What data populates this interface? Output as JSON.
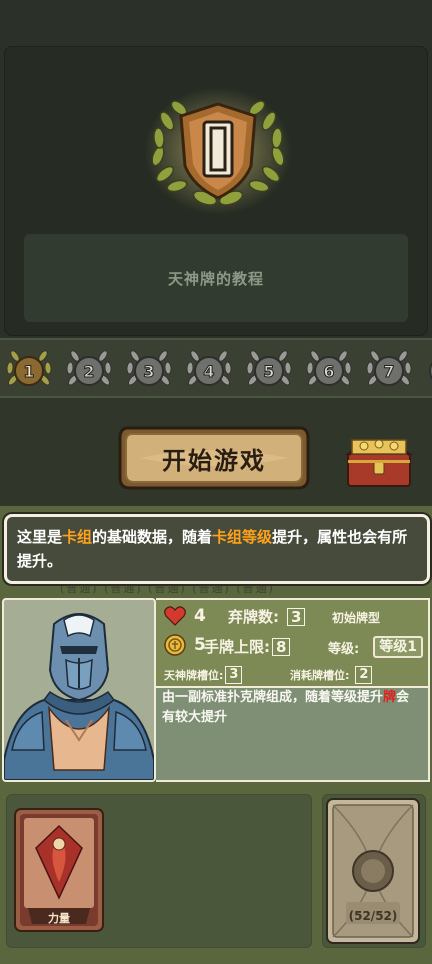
{
  "mode": {
    "emblem_numeral": "I",
    "title": "天神牌的教程"
  },
  "levels": [
    {
      "num": "1",
      "selected": true
    },
    {
      "num": "2",
      "selected": false
    },
    {
      "num": "3",
      "selected": false
    },
    {
      "num": "4",
      "selected": false
    },
    {
      "num": "5",
      "selected": false
    },
    {
      "num": "6",
      "selected": false
    },
    {
      "num": "7",
      "selected": false
    }
  ],
  "start_button": "开始游戏",
  "tip": {
    "part1": "这里是",
    "hl1": "卡组",
    "part2": "的基础数据，随着",
    "hl2": "卡组等级",
    "part3": "提升，属性也会有所提升。"
  },
  "faint_row": "(普通) (普通) (普通) (普通) (普通)",
  "stats": {
    "hp": "4",
    "discard_label": "弃牌数:",
    "discard_value": "3",
    "deck_type": "初始牌型",
    "coin": "5",
    "hand_label": "手牌上限:",
    "hand_value": "8",
    "level_label": "等级:",
    "level_value": "等级1",
    "god_slot_label": "天神牌槽位:",
    "god_slot_value": "3",
    "consume_slot_label": "消耗牌槽位:",
    "consume_slot_value": "2"
  },
  "description": {
    "text1": "由一副标准扑克牌组成，随着等级提升",
    "red": "牌",
    "text2": "会有较大提升"
  },
  "hand_card": {
    "label": "力量"
  },
  "deck": {
    "count": "(52/52)"
  },
  "colors": {
    "accent_orange": "#ffa21c",
    "panel_green": "#59663e",
    "gold": "#c9a43a"
  }
}
